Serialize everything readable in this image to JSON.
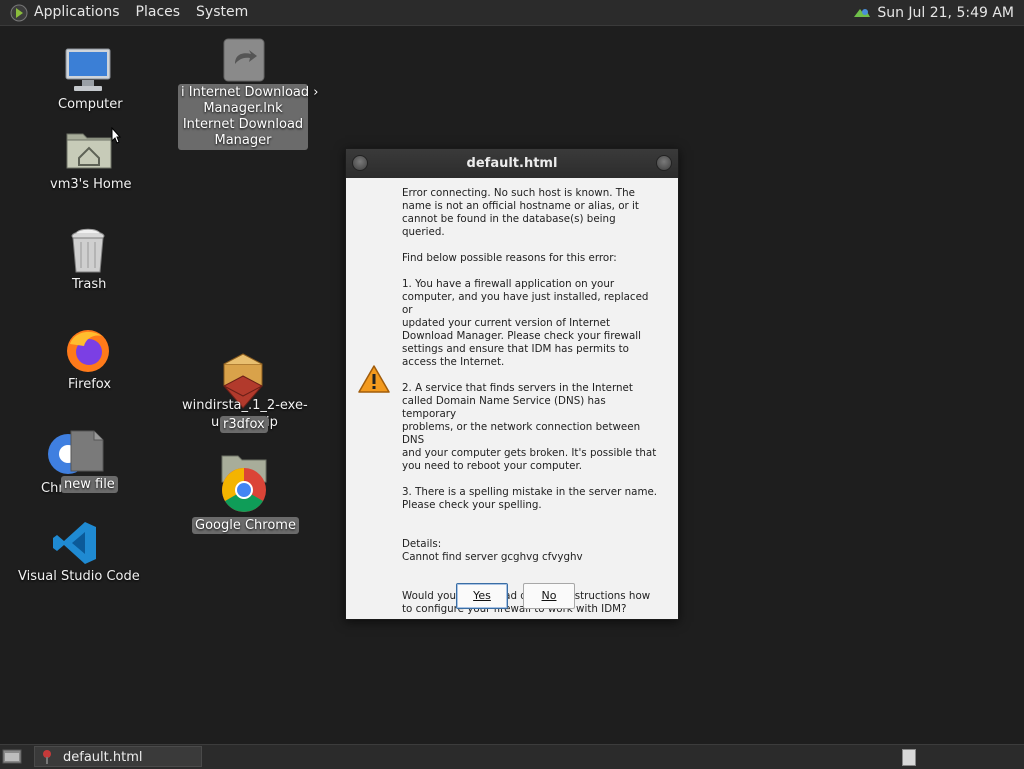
{
  "top_panel": {
    "menus": [
      "Applications",
      "Places",
      "System"
    ],
    "clock": "Sun Jul 21,  5:49 AM"
  },
  "desktop": {
    "computer": "Computer",
    "home": "vm3's Home",
    "trash": "Trash",
    "firefox": "Firefox",
    "chrome_partial": "Chr",
    "new_file": "new file",
    "vscode": "Visual Studio Code",
    "idm_lnk_line1": "i Internet Download ›",
    "idm_lnk_line2": "Manager.lnk",
    "idm_line1": "Internet Download",
    "idm_line2": "Manager",
    "windirstat_line1": "windirsta_.1_2-exe-",
    "windirstat_line2_left": "u",
    "windirstat_line2_right": "ip",
    "r3dfox": "r3dfox",
    "google_chrome": "Google Chrome"
  },
  "dialog": {
    "title": "default.html",
    "message": "Error connecting. No such host is known. The\nname is not an official hostname or alias, or it\ncannot be found in the database(s) being\nqueried.\n\nFind below possible reasons for this error:\n\n1. You have a firewall application on your\ncomputer, and you have just installed, replaced or\nupdated your current version of Internet\nDownload Manager. Please check your firewall\nsettings and ensure that IDM has permits to\naccess the Internet.\n\n2. A service that finds servers in the Internet\ncalled Domain Name Service (DNS) has temporary\nproblems, or the network connection between DNS\nand your computer gets broken. It's possible that\nyou need to reboot your computer.\n\n3. There is a spelling mistake in the server name.\nPlease check your spelling.\n\n\nDetails:\nCannot find server gcghvg cfvyghv\n\n\nWould you like to read detailed instructions how\nto configure your firewall to work with IDM?",
    "yes_label": "Yes",
    "no_label": "No"
  },
  "taskbar": {
    "window_title": "default.html"
  }
}
